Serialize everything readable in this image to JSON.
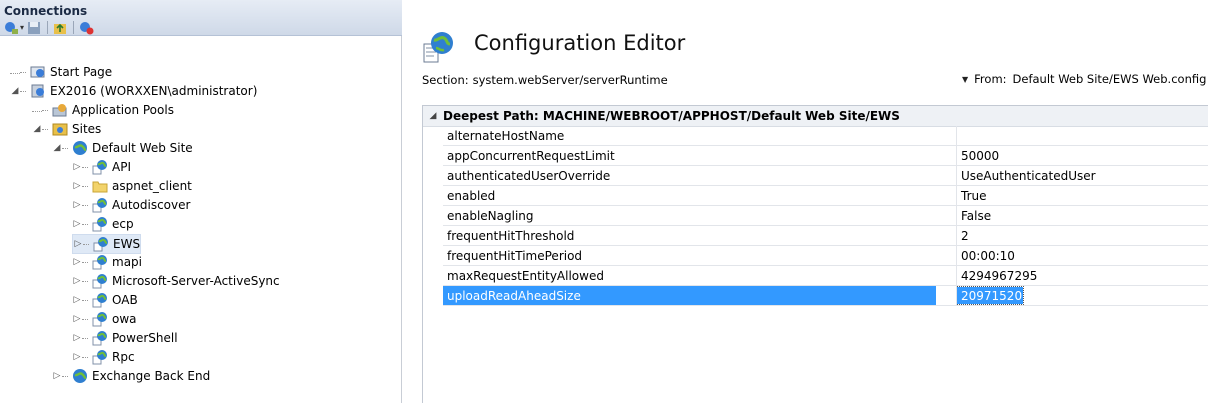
{
  "connections": {
    "title": "Connections",
    "toolbar": [
      "connect-icon",
      "save-icon",
      "folder-up-icon",
      "disconnect-icon"
    ]
  },
  "tree": [
    {
      "id": "start-page",
      "label": "Start Page",
      "level": 0,
      "icon": "start-page-icon",
      "expander": ""
    },
    {
      "id": "server",
      "label": "EX2016 (WORXXEN\\administrator)",
      "level": 0,
      "icon": "server-icon",
      "expander": "◢"
    },
    {
      "id": "app-pools",
      "label": "Application Pools",
      "level": 1,
      "icon": "app-pool-icon",
      "expander": ""
    },
    {
      "id": "sites",
      "label": "Sites",
      "level": 1,
      "icon": "sites-folder-icon",
      "expander": "◢"
    },
    {
      "id": "default-web-site",
      "label": "Default Web Site",
      "level": 2,
      "icon": "globe-icon",
      "expander": "◢"
    },
    {
      "id": "api",
      "label": "API",
      "level": 3,
      "icon": "web-app-icon",
      "expander": "▷"
    },
    {
      "id": "aspnet-client",
      "label": "aspnet_client",
      "level": 3,
      "icon": "folder-icon",
      "expander": "▷"
    },
    {
      "id": "autodiscover",
      "label": "Autodiscover",
      "level": 3,
      "icon": "web-app-icon",
      "expander": "▷"
    },
    {
      "id": "ecp",
      "label": "ecp",
      "level": 3,
      "icon": "web-app-icon",
      "expander": "▷"
    },
    {
      "id": "ews",
      "label": "EWS",
      "level": 3,
      "icon": "web-app-icon",
      "expander": "▷",
      "selected": true
    },
    {
      "id": "mapi",
      "label": "mapi",
      "level": 3,
      "icon": "web-app-icon",
      "expander": "▷"
    },
    {
      "id": "activesync",
      "label": "Microsoft-Server-ActiveSync",
      "level": 3,
      "icon": "web-app-icon",
      "expander": "▷"
    },
    {
      "id": "oab",
      "label": "OAB",
      "level": 3,
      "icon": "web-app-icon",
      "expander": "▷"
    },
    {
      "id": "owa",
      "label": "owa",
      "level": 3,
      "icon": "web-app-icon",
      "expander": "▷"
    },
    {
      "id": "powershell",
      "label": "PowerShell",
      "level": 3,
      "icon": "web-app-icon",
      "expander": "▷"
    },
    {
      "id": "rpc",
      "label": "Rpc",
      "level": 3,
      "icon": "web-app-icon",
      "expander": "▷"
    },
    {
      "id": "exchange-back-end",
      "label": "Exchange Back End",
      "level": 2,
      "icon": "globe-icon",
      "expander": "▷"
    }
  ],
  "editor": {
    "title": "Configuration Editor",
    "section_label": "Section:",
    "section_value": "system.webServer/serverRuntime",
    "from_label": "From:",
    "from_value": "Default Web Site/EWS Web.config",
    "group_header": "Deepest Path: MACHINE/WEBROOT/APPHOST/Default Web Site/EWS",
    "rows": [
      {
        "name": "alternateHostName",
        "value": ""
      },
      {
        "name": "appConcurrentRequestLimit",
        "value": "50000"
      },
      {
        "name": "authenticatedUserOverride",
        "value": "UseAuthenticatedUser"
      },
      {
        "name": "enabled",
        "value": "True"
      },
      {
        "name": "enableNagling",
        "value": "False"
      },
      {
        "name": "frequentHitThreshold",
        "value": "2"
      },
      {
        "name": "frequentHitTimePeriod",
        "value": "00:00:10"
      },
      {
        "name": "maxRequestEntityAllowed",
        "value": "4294967295"
      },
      {
        "name": "uploadReadAheadSize",
        "value": "20971520",
        "selected": true
      }
    ]
  },
  "colors": {
    "selection": "#3399ff",
    "header_bg": "#cfd9e8"
  }
}
